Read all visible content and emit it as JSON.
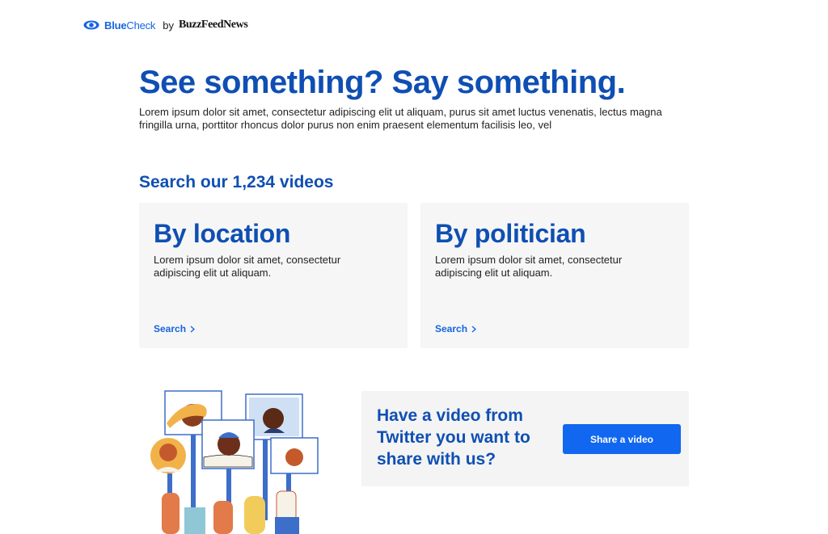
{
  "header": {
    "brand_blue": "Blue",
    "brand_check": "Check",
    "by": "by",
    "partner_buzzfeed": "BuzzFeed",
    "partner_news": "News",
    "eye_icon": "eye-icon"
  },
  "hero": {
    "title": "See something? Say something.",
    "description": "Lorem ipsum dolor sit amet, consectetur adipiscing elit ut aliquam, purus sit amet luctus venenatis, lectus magna fringilla urna, porttitor rhoncus dolor purus non enim praesent elementum facilisis leo, vel"
  },
  "search": {
    "heading": "Search our 1,234 videos",
    "cards": [
      {
        "title": "By location",
        "description": "Lorem ipsum dolor sit amet, consectetur adipiscing elit ut aliquam.",
        "link_label": "Search",
        "link_icon": "chevron-right-icon"
      },
      {
        "title": "By politician",
        "description": "Lorem ipsum dolor sit amet, consectetur adipiscing elit ut aliquam.",
        "link_label": "Search",
        "link_icon": "chevron-right-icon"
      }
    ]
  },
  "share": {
    "prompt": "Have a video from Twitter you want to share with us?",
    "button_label": "Share a video"
  },
  "colors": {
    "brand_blue": "#0f4fb3",
    "link_blue": "#1565e0",
    "button_blue": "#1167ef",
    "card_bg": "#f6f6f6"
  }
}
